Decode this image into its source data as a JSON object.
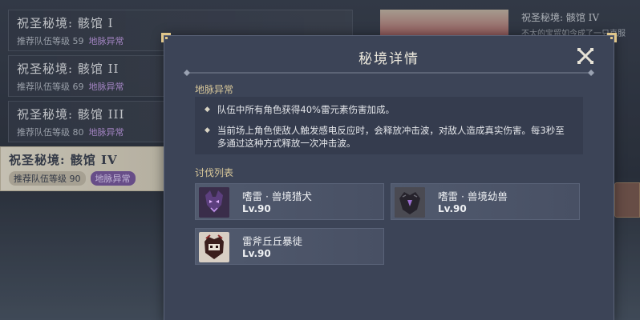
{
  "domain_list": [
    {
      "name": "祝圣秘境: 骸馆 I",
      "recommended_level": "推荐队伍等级 59",
      "ley_badge": "地脉异常"
    },
    {
      "name": "祝圣秘境: 骸馆 II",
      "recommended_level": "推荐队伍等级 69",
      "ley_badge": "地脉异常"
    },
    {
      "name": "祝圣秘境: 骸馆 III",
      "recommended_level": "推荐队伍等级 80",
      "ley_badge": "地脉异常"
    },
    {
      "name": "祝圣秘境: 骸馆 IV",
      "recommended_level": "推荐队伍等级 90",
      "ley_badge": "地脉异常",
      "selected": true
    }
  ],
  "background_card": {
    "title": "祝圣秘境: 骸馆 IV",
    "description": "不太的宝贸如今成了一只克服"
  },
  "modal": {
    "title": "秘境详情",
    "ley_section": {
      "heading": "地脉异常",
      "lines": [
        "队伍中所有角色获得40%雷元素伤害加成。",
        "当前场上角色使敌人触发感电反应时，会释放冲击波，对敌人造成真实伤害。每3秒至多通过这种方式释放一次冲击波。"
      ]
    },
    "enemy_section": {
      "heading": "讨伐列表",
      "enemies": [
        {
          "name": "嗜雷 · 兽境猎犬",
          "level": "Lv.90"
        },
        {
          "name": "嗜雷 · 兽境幼兽",
          "level": "Lv.90"
        },
        {
          "name": "雷斧丘丘暴徒",
          "level": "Lv.90"
        }
      ]
    }
  },
  "icons": {
    "close": "close-icon",
    "bullet": "diamond-bullet-icon",
    "corner": "corner-ornament-icon"
  },
  "colors": {
    "modal_bg": "#3c4457",
    "heading_gold": "#d9c89a",
    "ley_purple": "#c29ce6",
    "selected_item_bg": "#ece5d3"
  }
}
